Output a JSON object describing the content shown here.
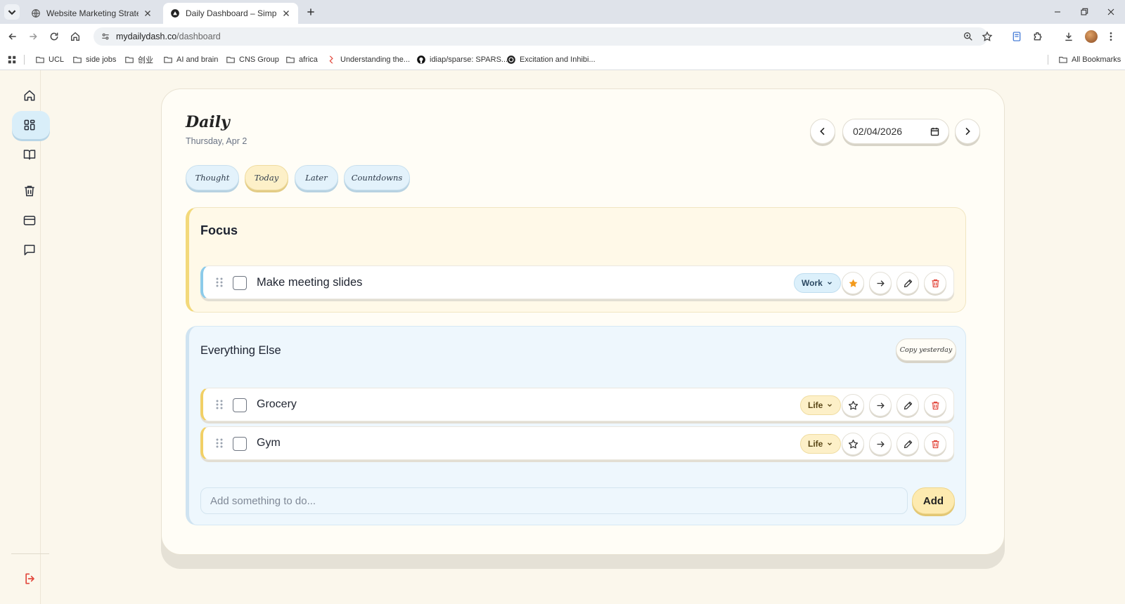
{
  "browser": {
    "tabs": [
      {
        "title": "Website Marketing Strategies",
        "active": false
      },
      {
        "title": "Daily Dashboard – Simple Life &",
        "active": true
      }
    ],
    "url_host": "mydailydash.co",
    "url_path": "/dashboard",
    "bookmarks": [
      {
        "label": "UCL",
        "icon": "folder-icon"
      },
      {
        "label": "side jobs",
        "icon": "folder-icon"
      },
      {
        "label": "创业",
        "icon": "folder-icon"
      },
      {
        "label": "AI and brain",
        "icon": "folder-icon"
      },
      {
        "label": "CNS Group",
        "icon": "folder-icon"
      },
      {
        "label": "africa",
        "icon": "folder-icon"
      },
      {
        "label": "Understanding the...",
        "icon": "bookmark-favicon"
      },
      {
        "label": "idiap/sparse: SPARS...",
        "icon": "github-icon"
      },
      {
        "label": "Excitation and Inhibi...",
        "icon": "site-favicon"
      }
    ],
    "all_bookmarks_label": "All Bookmarks"
  },
  "sidebar": {
    "items": [
      {
        "icon": "home-icon",
        "active": false
      },
      {
        "icon": "dashboard-grid-icon",
        "active": true
      },
      {
        "icon": "book-icon",
        "active": false
      },
      {
        "icon": "trash-icon",
        "active": false
      },
      {
        "icon": "card-icon",
        "active": false
      },
      {
        "icon": "chat-icon",
        "active": false
      }
    ],
    "logout_icon": "logout-icon"
  },
  "header": {
    "title": "Daily",
    "date_label": "Thursday, Apr 2",
    "date_value": "02/04/2026"
  },
  "chips": [
    "Thought",
    "Today",
    "Later",
    "Countdowns"
  ],
  "focus": {
    "title": "Focus",
    "tasks": [
      {
        "text": "Make meeting slides",
        "tag": "Work",
        "starred": true
      }
    ]
  },
  "everything_else": {
    "title": "Everything Else",
    "copy_label": "Copy yesterday",
    "tasks": [
      {
        "text": "Grocery",
        "tag": "Life",
        "starred": false
      },
      {
        "text": "Gym",
        "tag": "Life",
        "starred": false
      }
    ],
    "input_placeholder": "Add something to do...",
    "add_label": "Add"
  },
  "colors": {
    "page_bg": "#fbf7ec",
    "focus_accent": "#f3d97a",
    "work_accent": "#8ccbea",
    "life_accent": "#f1d066",
    "star_active": "#f39a1c",
    "delete": "#e2483d"
  }
}
